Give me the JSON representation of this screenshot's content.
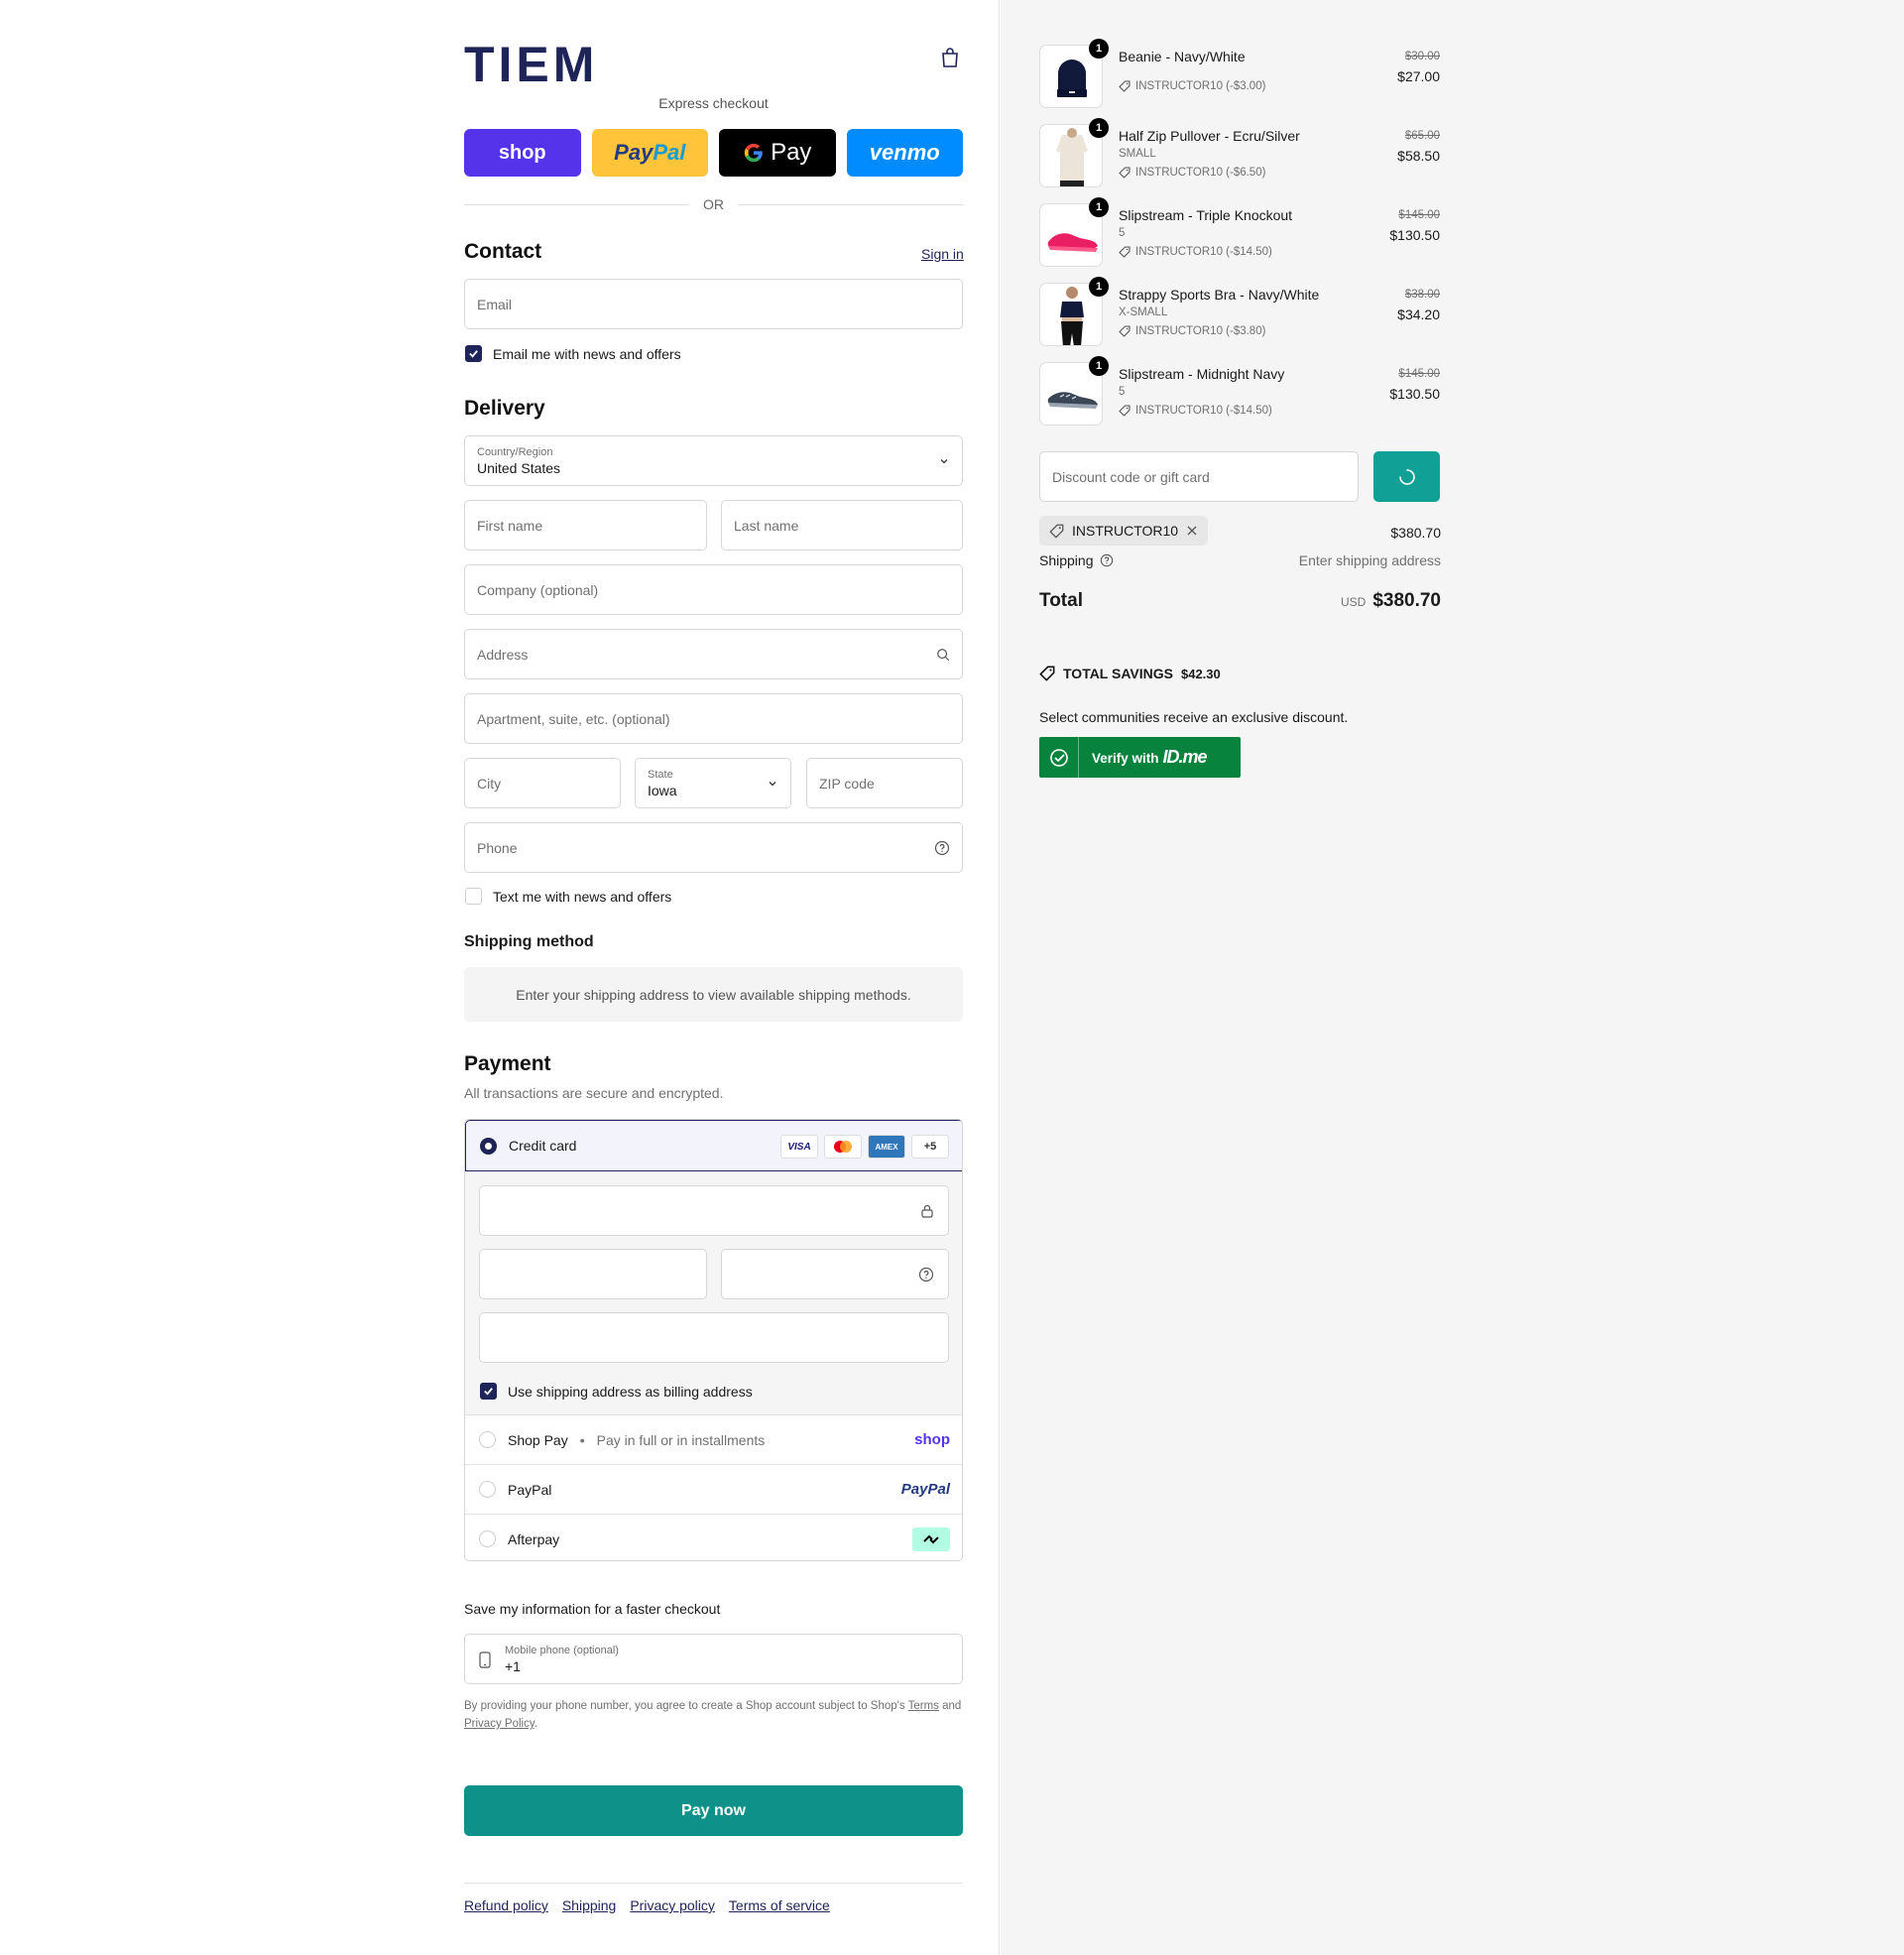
{
  "brand": {
    "logo_text": "TIEM"
  },
  "express": {
    "label": "Express checkout",
    "shop": "shop",
    "paypal_1": "Pay",
    "paypal_2": "Pal",
    "gpay": "Pay",
    "venmo": "venmo",
    "or": "OR"
  },
  "contact": {
    "title": "Contact",
    "sign_in": "Sign in",
    "email_placeholder": "Email",
    "email_optin": "Email me with news and offers",
    "email_optin_checked": true
  },
  "delivery": {
    "title": "Delivery",
    "country_label": "Country/Region",
    "country_value": "United States",
    "first_name": "First name",
    "last_name": "Last name",
    "company": "Company (optional)",
    "address": "Address",
    "apartment": "Apartment, suite, etc. (optional)",
    "city": "City",
    "state_label": "State",
    "state_value": "Iowa",
    "zip": "ZIP code",
    "phone": "Phone",
    "text_optin": "Text me with news and offers",
    "text_optin_checked": false
  },
  "shipping_method": {
    "title": "Shipping method",
    "note": "Enter your shipping address to view available shipping methods."
  },
  "payment": {
    "title": "Payment",
    "subtitle": "All transactions are secure and encrypted.",
    "credit_card": "Credit card",
    "card_brands": [
      "VISA",
      "",
      "AMEX",
      "+5"
    ],
    "billing_same": "Use shipping address as billing address",
    "shop_pay": "Shop Pay",
    "shop_pay_sub": "Pay in full or in installments",
    "shop_pay_brand": "shop",
    "paypal": "PayPal",
    "paypal_brand": "PayPal",
    "afterpay": "Afterpay"
  },
  "save_info": {
    "label": "Save my information for a faster checkout",
    "mobile_label": "Mobile phone (optional)",
    "mobile_value": "+1",
    "fine_1": "By providing your phone number, you agree to create a Shop account subject to Shop's",
    "terms": "Terms",
    "fine_2": "and",
    "privacy": "Privacy Policy",
    "fine_3": "."
  },
  "pay_now": "Pay now",
  "footer": [
    "Refund policy",
    "Shipping",
    "Privacy policy",
    "Terms of service"
  ],
  "cart": {
    "items": [
      {
        "name": "Beanie - Navy/White",
        "variant": "",
        "discount": "INSTRUCTOR10 (-$3.00)",
        "original": "$30.00",
        "price": "$27.00",
        "qty": "1"
      },
      {
        "name": "Half Zip Pullover - Ecru/Silver",
        "variant": "SMALL",
        "discount": "INSTRUCTOR10 (-$6.50)",
        "original": "$65.00",
        "price": "$58.50",
        "qty": "1"
      },
      {
        "name": "Slipstream - Triple Knockout",
        "variant": "5",
        "discount": "INSTRUCTOR10 (-$14.50)",
        "original": "$145.00",
        "price": "$130.50",
        "qty": "1"
      },
      {
        "name": "Strappy Sports Bra - Navy/White",
        "variant": "X-SMALL",
        "discount": "INSTRUCTOR10 (-$3.80)",
        "original": "$38.00",
        "price": "$34.20",
        "qty": "1"
      },
      {
        "name": "Slipstream - Midnight Navy",
        "variant": "5",
        "discount": "INSTRUCTOR10 (-$14.50)",
        "original": "$145.00",
        "price": "$130.50",
        "qty": "1"
      }
    ],
    "discount_placeholder": "Discount code or gift card",
    "applied_code": "INSTRUCTOR10",
    "subtotal": "$380.70",
    "shipping_label": "Shipping",
    "shipping_value": "Enter shipping address",
    "total_label": "Total",
    "currency": "USD",
    "total": "$380.70",
    "savings_label": "TOTAL SAVINGS",
    "savings_value": "$42.30",
    "communities": "Select communities receive an exclusive discount.",
    "idme_text": "Verify with",
    "idme_brand": "ID.me"
  },
  "colors": {
    "primary": "#1e2358",
    "accent": "#0e9188",
    "idme": "#08833d"
  }
}
